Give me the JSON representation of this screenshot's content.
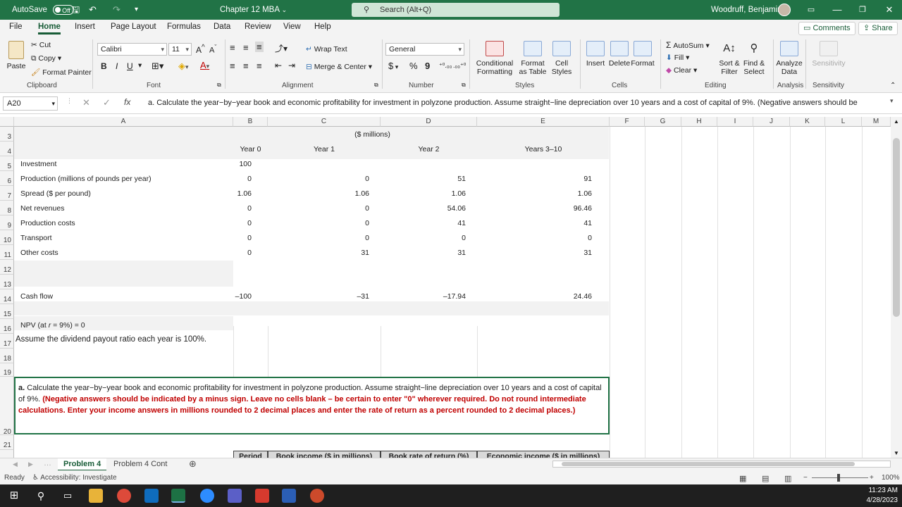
{
  "titlebar": {
    "autosave_label": "AutoSave",
    "autosave_state": "Off",
    "doc_title": "Chapter 12 MBA",
    "search_placeholder": "Search (Alt+Q)",
    "user_name": "Woodruff, Benjamin"
  },
  "menu": {
    "tabs": [
      "File",
      "Home",
      "Insert",
      "Page Layout",
      "Formulas",
      "Data",
      "Review",
      "View",
      "Help"
    ],
    "active_tab": "Home",
    "comments_label": "Comments",
    "share_label": "Share"
  },
  "ribbon": {
    "clipboard": {
      "paste": "Paste",
      "cut": "Cut",
      "copy": "Copy",
      "format_painter": "Format Painter",
      "label": "Clipboard"
    },
    "font": {
      "name": "Calibri",
      "size": "11",
      "label": "Font",
      "bold": "B",
      "italic": "I",
      "underline": "U"
    },
    "alignment": {
      "wrap_text": "Wrap Text",
      "merge_center": "Merge & Center",
      "label": "Alignment"
    },
    "number": {
      "format": "General",
      "label": "Number",
      "currency": "$",
      "percent": "%",
      "comma": "9"
    },
    "styles": {
      "conditional": "Conditional Formatting",
      "format_table": "Format as Table",
      "cell_styles": "Cell Styles",
      "label": "Styles"
    },
    "cells": {
      "insert": "Insert",
      "delete": "Delete",
      "format": "Format",
      "label": "Cells"
    },
    "editing": {
      "autosum": "AutoSum",
      "fill": "Fill",
      "clear": "Clear",
      "sort_filter": "Sort & Filter",
      "find_select": "Find & Select",
      "label": "Editing"
    },
    "analysis": {
      "analyze": "Analyze Data",
      "label": "Analysis"
    },
    "sensitivity": {
      "btn": "Sensitivity",
      "label": "Sensitivity"
    }
  },
  "formula_bar": {
    "cell_ref": "A20",
    "fx": "fx",
    "content": "a. Calculate the year−by−year book and economic profitability for investment in polyzone production. Assume straight−line depreciation over 10 years and a cost of capital of 9%. (Negative answers should be"
  },
  "columns": [
    "A",
    "B",
    "C",
    "D",
    "E",
    "F",
    "G",
    "H",
    "I",
    "J",
    "K",
    "L",
    "M"
  ],
  "rows": [
    "3",
    "4",
    "5",
    "6",
    "7",
    "8",
    "9",
    "10",
    "11",
    "12",
    "13",
    "14",
    "15",
    "16",
    "17",
    "18",
    "19",
    "20",
    "21"
  ],
  "sheet": {
    "units": "($ millions)",
    "headers": [
      "Year 0",
      "Year 1",
      "Year 2",
      "Years 3–10"
    ],
    "table": [
      {
        "label": "Investment",
        "values": [
          "100",
          "",
          "",
          ""
        ]
      },
      {
        "label": "Production (millions of pounds per year)",
        "values": [
          "0",
          "0",
          "51",
          "91"
        ]
      },
      {
        "label": "Spread ($ per pound)",
        "values": [
          "1.06",
          "1.06",
          "1.06",
          "1.06"
        ]
      },
      {
        "label": "Net revenues",
        "values": [
          "0",
          "0",
          "54.06",
          "96.46"
        ]
      },
      {
        "label": "Production costs",
        "values": [
          "0",
          "0",
          "41",
          "41"
        ]
      },
      {
        "label": "Transport",
        "values": [
          "0",
          "0",
          "0",
          "0"
        ]
      },
      {
        "label": "Other costs",
        "values": [
          "0",
          "31",
          "31",
          "31"
        ]
      }
    ],
    "cash_flow": {
      "label": "Cash flow",
      "values": [
        "–100",
        "–31",
        "–17.94",
        "24.46"
      ]
    },
    "npv_prefix": "NPV (at ",
    "npv_r": "r",
    "npv_suffix": " = 9%) = 0",
    "payout_note": "Assume the dividend payout ratio each year is 100%.",
    "question_lead": "a.",
    "question_text": " Calculate the year−by−year book and economic profitability for investment in polyzone production. Assume straight−line depreciation over 10 years and a cost of capital of 9%. ",
    "question_red": "(Negative answers should be indicated by a minus sign. Leave no cells blank – be certain to enter \"0\" wherever required. Do not round intermediate calculations. Enter your income answers in millions rounded to 2 decimal places and enter the rate of return as a percent rounded to 2 decimal places.)",
    "row21_headers": [
      "Period",
      "Book income ($ in millions)",
      "Book rate of return (%)",
      "Economic income ($ in millions)"
    ]
  },
  "sheet_tabs": [
    "Problem 4",
    "Problem 4 Cont"
  ],
  "active_sheet": "Problem 4",
  "status": {
    "ready": "Ready",
    "accessibility": "Accessibility: Investigate",
    "zoom": "100%"
  },
  "taskbar": {
    "time": "11:23 AM",
    "date": "4/28/2023"
  }
}
